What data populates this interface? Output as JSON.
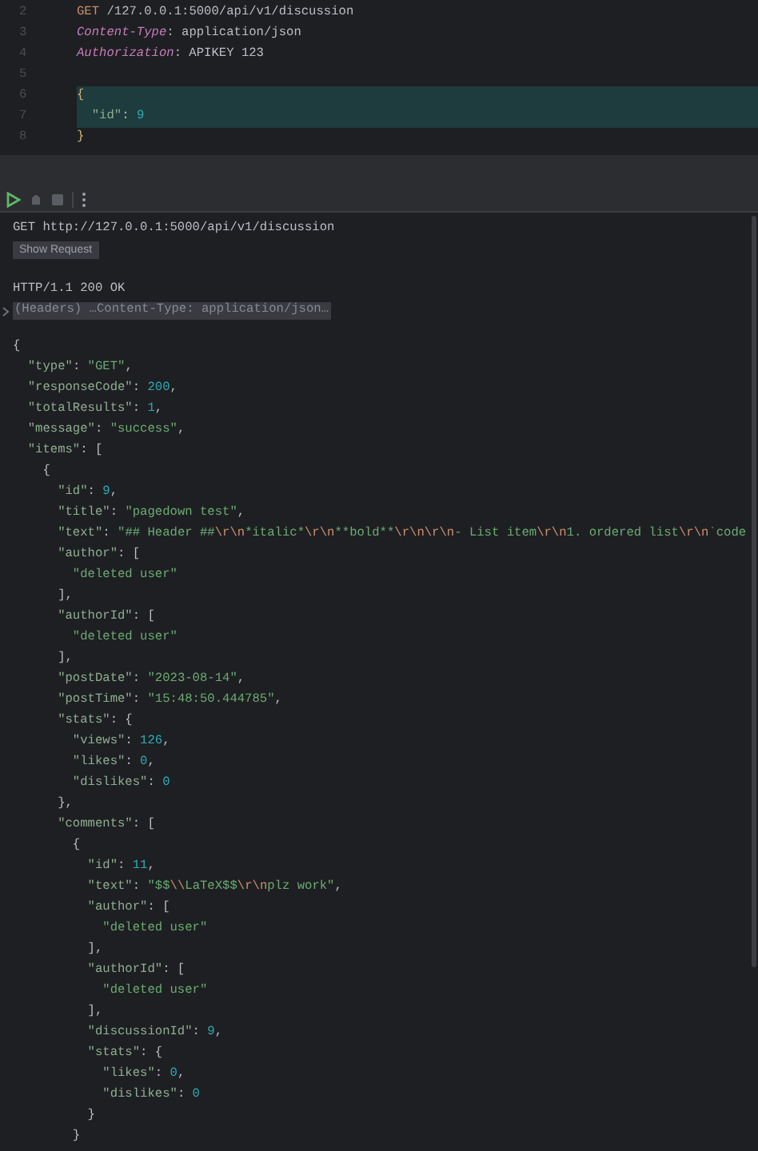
{
  "editor": {
    "lines": [
      {
        "number": "2",
        "highlighted": false,
        "tokens": [
          {
            "kind": "m",
            "text": "GET"
          },
          {
            "kind": "p",
            "text": " /127.0.0.1:5000/api/v1/discussion"
          }
        ]
      },
      {
        "number": "3",
        "highlighted": false,
        "tokens": [
          {
            "kind": "h",
            "text": "Content-Type"
          },
          {
            "kind": "p",
            "text": ": application/json"
          }
        ]
      },
      {
        "number": "4",
        "highlighted": false,
        "tokens": [
          {
            "kind": "h",
            "text": "Authorization"
          },
          {
            "kind": "p",
            "text": ": APIKEY 123"
          }
        ]
      },
      {
        "number": "5",
        "highlighted": false
      },
      {
        "number": "6",
        "highlighted": true,
        "tokens": [
          {
            "kind": "b",
            "text": "{"
          }
        ]
      },
      {
        "number": "7",
        "highlighted": true,
        "tokens": [
          {
            "kind": "k",
            "text": "  \"id\""
          },
          {
            "kind": "p",
            "text": ": "
          },
          {
            "kind": "n",
            "text": "9"
          }
        ]
      },
      {
        "number": "8",
        "highlighted": false,
        "tokens": [
          {
            "kind": "b",
            "text": "}"
          }
        ]
      }
    ]
  },
  "response": {
    "request_line": "GET http://127.0.0.1:5000/api/v1/discussion",
    "show_request_button": "Show Request",
    "status_line": "HTTP/1.1 200 OK",
    "headers_summary": "(Headers) …Content-Type: application/json…",
    "body_lines": [
      [
        {
          "kind": "p",
          "text": "{"
        }
      ],
      [
        {
          "kind": "k",
          "text": "  \"type\""
        },
        {
          "kind": "p",
          "text": ": "
        },
        {
          "kind": "s",
          "text": "\"GET\""
        },
        {
          "kind": "p",
          "text": ","
        }
      ],
      [
        {
          "kind": "k",
          "text": "  \"responseCode\""
        },
        {
          "kind": "p",
          "text": ": "
        },
        {
          "kind": "n",
          "text": "200"
        },
        {
          "kind": "p",
          "text": ","
        }
      ],
      [
        {
          "kind": "k",
          "text": "  \"totalResults\""
        },
        {
          "kind": "p",
          "text": ": "
        },
        {
          "kind": "n",
          "text": "1"
        },
        {
          "kind": "p",
          "text": ","
        }
      ],
      [
        {
          "kind": "k",
          "text": "  \"message\""
        },
        {
          "kind": "p",
          "text": ": "
        },
        {
          "kind": "s",
          "text": "\"success\""
        },
        {
          "kind": "p",
          "text": ","
        }
      ],
      [
        {
          "kind": "k",
          "text": "  \"items\""
        },
        {
          "kind": "p",
          "text": ": ["
        }
      ],
      [
        {
          "kind": "p",
          "text": "    {"
        }
      ],
      [
        {
          "kind": "k",
          "text": "      \"id\""
        },
        {
          "kind": "p",
          "text": ": "
        },
        {
          "kind": "n",
          "text": "9"
        },
        {
          "kind": "p",
          "text": ","
        }
      ],
      [
        {
          "kind": "k",
          "text": "      \"title\""
        },
        {
          "kind": "p",
          "text": ": "
        },
        {
          "kind": "s",
          "text": "\"pagedown test\""
        },
        {
          "kind": "p",
          "text": ","
        }
      ],
      [
        {
          "kind": "k",
          "text": "      \"text\""
        },
        {
          "kind": "p",
          "text": ": "
        },
        {
          "kind": "s",
          "text": "\"## Header ##"
        },
        {
          "kind": "e",
          "text": "\\r\\n"
        },
        {
          "kind": "s",
          "text": "*italic*"
        },
        {
          "kind": "e",
          "text": "\\r\\n"
        },
        {
          "kind": "s",
          "text": "**bold**"
        },
        {
          "kind": "e",
          "text": "\\r\\n\\r\\n"
        },
        {
          "kind": "s",
          "text": "- List item"
        },
        {
          "kind": "e",
          "text": "\\r\\n"
        },
        {
          "kind": "s",
          "text": "1. ordered list"
        },
        {
          "kind": "e",
          "text": "\\r\\n"
        },
        {
          "kind": "s",
          "text": "`code"
        }
      ],
      [
        {
          "kind": "k",
          "text": "      \"author\""
        },
        {
          "kind": "p",
          "text": ": ["
        }
      ],
      [
        {
          "kind": "s",
          "text": "        \"deleted user\""
        }
      ],
      [
        {
          "kind": "p",
          "text": "      ],"
        }
      ],
      [
        {
          "kind": "k",
          "text": "      \"authorId\""
        },
        {
          "kind": "p",
          "text": ": ["
        }
      ],
      [
        {
          "kind": "s",
          "text": "        \"deleted user\""
        }
      ],
      [
        {
          "kind": "p",
          "text": "      ],"
        }
      ],
      [
        {
          "kind": "k",
          "text": "      \"postDate\""
        },
        {
          "kind": "p",
          "text": ": "
        },
        {
          "kind": "s",
          "text": "\"2023-08-14\""
        },
        {
          "kind": "p",
          "text": ","
        }
      ],
      [
        {
          "kind": "k",
          "text": "      \"postTime\""
        },
        {
          "kind": "p",
          "text": ": "
        },
        {
          "kind": "s",
          "text": "\"15:48:50.444785\""
        },
        {
          "kind": "p",
          "text": ","
        }
      ],
      [
        {
          "kind": "k",
          "text": "      \"stats\""
        },
        {
          "kind": "p",
          "text": ": {"
        }
      ],
      [
        {
          "kind": "k",
          "text": "        \"views\""
        },
        {
          "kind": "p",
          "text": ": "
        },
        {
          "kind": "n",
          "text": "126"
        },
        {
          "kind": "p",
          "text": ","
        }
      ],
      [
        {
          "kind": "k",
          "text": "        \"likes\""
        },
        {
          "kind": "p",
          "text": ": "
        },
        {
          "kind": "n",
          "text": "0"
        },
        {
          "kind": "p",
          "text": ","
        }
      ],
      [
        {
          "kind": "k",
          "text": "        \"dislikes\""
        },
        {
          "kind": "p",
          "text": ": "
        },
        {
          "kind": "n",
          "text": "0"
        }
      ],
      [
        {
          "kind": "p",
          "text": "      },"
        }
      ],
      [
        {
          "kind": "k",
          "text": "      \"comments\""
        },
        {
          "kind": "p",
          "text": ": ["
        }
      ],
      [
        {
          "kind": "p",
          "text": "        {"
        }
      ],
      [
        {
          "kind": "k",
          "text": "          \"id\""
        },
        {
          "kind": "p",
          "text": ": "
        },
        {
          "kind": "n",
          "text": "11"
        },
        {
          "kind": "p",
          "text": ","
        }
      ],
      [
        {
          "kind": "k",
          "text": "          \"text\""
        },
        {
          "kind": "p",
          "text": ": "
        },
        {
          "kind": "s",
          "text": "\"$$"
        },
        {
          "kind": "e",
          "text": "\\\\"
        },
        {
          "kind": "s",
          "text": "LaTeX$$"
        },
        {
          "kind": "e",
          "text": "\\r\\n"
        },
        {
          "kind": "s",
          "text": "plz work\""
        },
        {
          "kind": "p",
          "text": ","
        }
      ],
      [
        {
          "kind": "k",
          "text": "          \"author\""
        },
        {
          "kind": "p",
          "text": ": ["
        }
      ],
      [
        {
          "kind": "s",
          "text": "            \"deleted user\""
        }
      ],
      [
        {
          "kind": "p",
          "text": "          ],"
        }
      ],
      [
        {
          "kind": "k",
          "text": "          \"authorId\""
        },
        {
          "kind": "p",
          "text": ": ["
        }
      ],
      [
        {
          "kind": "s",
          "text": "            \"deleted user\""
        }
      ],
      [
        {
          "kind": "p",
          "text": "          ],"
        }
      ],
      [
        {
          "kind": "k",
          "text": "          \"discussionId\""
        },
        {
          "kind": "p",
          "text": ": "
        },
        {
          "kind": "n",
          "text": "9"
        },
        {
          "kind": "p",
          "text": ","
        }
      ],
      [
        {
          "kind": "k",
          "text": "          \"stats\""
        },
        {
          "kind": "p",
          "text": ": {"
        }
      ],
      [
        {
          "kind": "k",
          "text": "            \"likes\""
        },
        {
          "kind": "p",
          "text": ": "
        },
        {
          "kind": "n",
          "text": "0"
        },
        {
          "kind": "p",
          "text": ","
        }
      ],
      [
        {
          "kind": "k",
          "text": "            \"dislikes\""
        },
        {
          "kind": "p",
          "text": ": "
        },
        {
          "kind": "n",
          "text": "0"
        }
      ],
      [
        {
          "kind": "p",
          "text": "          }"
        }
      ],
      [
        {
          "kind": "p",
          "text": "        }"
        }
      ]
    ]
  }
}
